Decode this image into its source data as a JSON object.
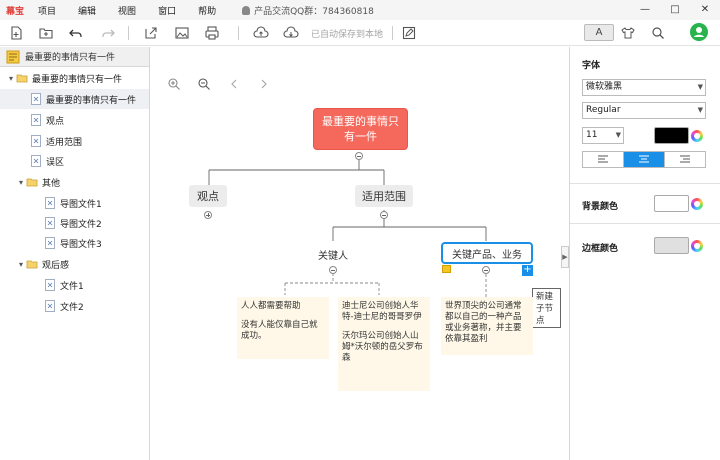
{
  "menubar": {
    "brand": "幕宝",
    "items": [
      "项目",
      "编辑",
      "视图",
      "窗口",
      "帮助"
    ],
    "qq_text": "产品交流QQ群：784360818"
  },
  "toolbar": {
    "autosave_text": "已自动保存到本地",
    "format_tab": "A"
  },
  "sidebar": {
    "header_title": "最重要的事情只有一件",
    "tree": [
      {
        "label": "最重要的事情只有一件",
        "type": "folder",
        "level": 0
      },
      {
        "label": "最重要的事情只有一件",
        "type": "file",
        "level": 1,
        "selected": true
      },
      {
        "label": "观点",
        "type": "file",
        "level": 1
      },
      {
        "label": "适用范围",
        "type": "file",
        "level": 1
      },
      {
        "label": "误区",
        "type": "file",
        "level": 1
      },
      {
        "label": "其他",
        "type": "folder",
        "level": 1
      },
      {
        "label": "导图文件1",
        "type": "file",
        "level": 2
      },
      {
        "label": "导图文件2",
        "type": "file",
        "level": 2
      },
      {
        "label": "导图文件3",
        "type": "file",
        "level": 2
      },
      {
        "label": "观后感",
        "type": "folder",
        "level": 1
      },
      {
        "label": "文件1",
        "type": "file",
        "level": 2
      },
      {
        "label": "文件2",
        "type": "file",
        "level": 2
      }
    ]
  },
  "mindmap": {
    "root_line1": "最重要的事情只",
    "root_line2": "有一件",
    "topic_viewpoint": "观点",
    "topic_scope": "适用范围",
    "sub_key_people": "关键人",
    "sub_key_products": "关键产品、业务",
    "note1_line1": "人人都需要帮助",
    "note1_line2": "没有人能仅靠自己就",
    "note1_line3": "成功。",
    "note2_line1": "迪士尼公司创始人华",
    "note2_line2": "特-迪士尼的哥哥罗伊",
    "note2_line3": "沃尔玛公司创始人山",
    "note2_line4": "姆*沃尔顿的岳父罗布",
    "note2_line5": "森",
    "note3_line1": "世界顶尖的公司通常",
    "note3_line2": "都以自己的一种产品",
    "note3_line3": "或业务著称，并主要",
    "note3_line4": "依靠其盈利",
    "tooltip": "新建子节点"
  },
  "format_panel": {
    "font_label": "字体",
    "font_family": "微软雅黑",
    "font_style": "Regular",
    "font_size": "11",
    "font_color": "#000000",
    "bg_color_label": "背景颜色",
    "bg_color": "#ffffff",
    "border_color_label": "边框颜色",
    "border_color": "#e0e0e0"
  },
  "colors": {
    "root_fill": "#f4695c",
    "accent": "#1a8fe8",
    "note_fill": "#fff8e8"
  }
}
